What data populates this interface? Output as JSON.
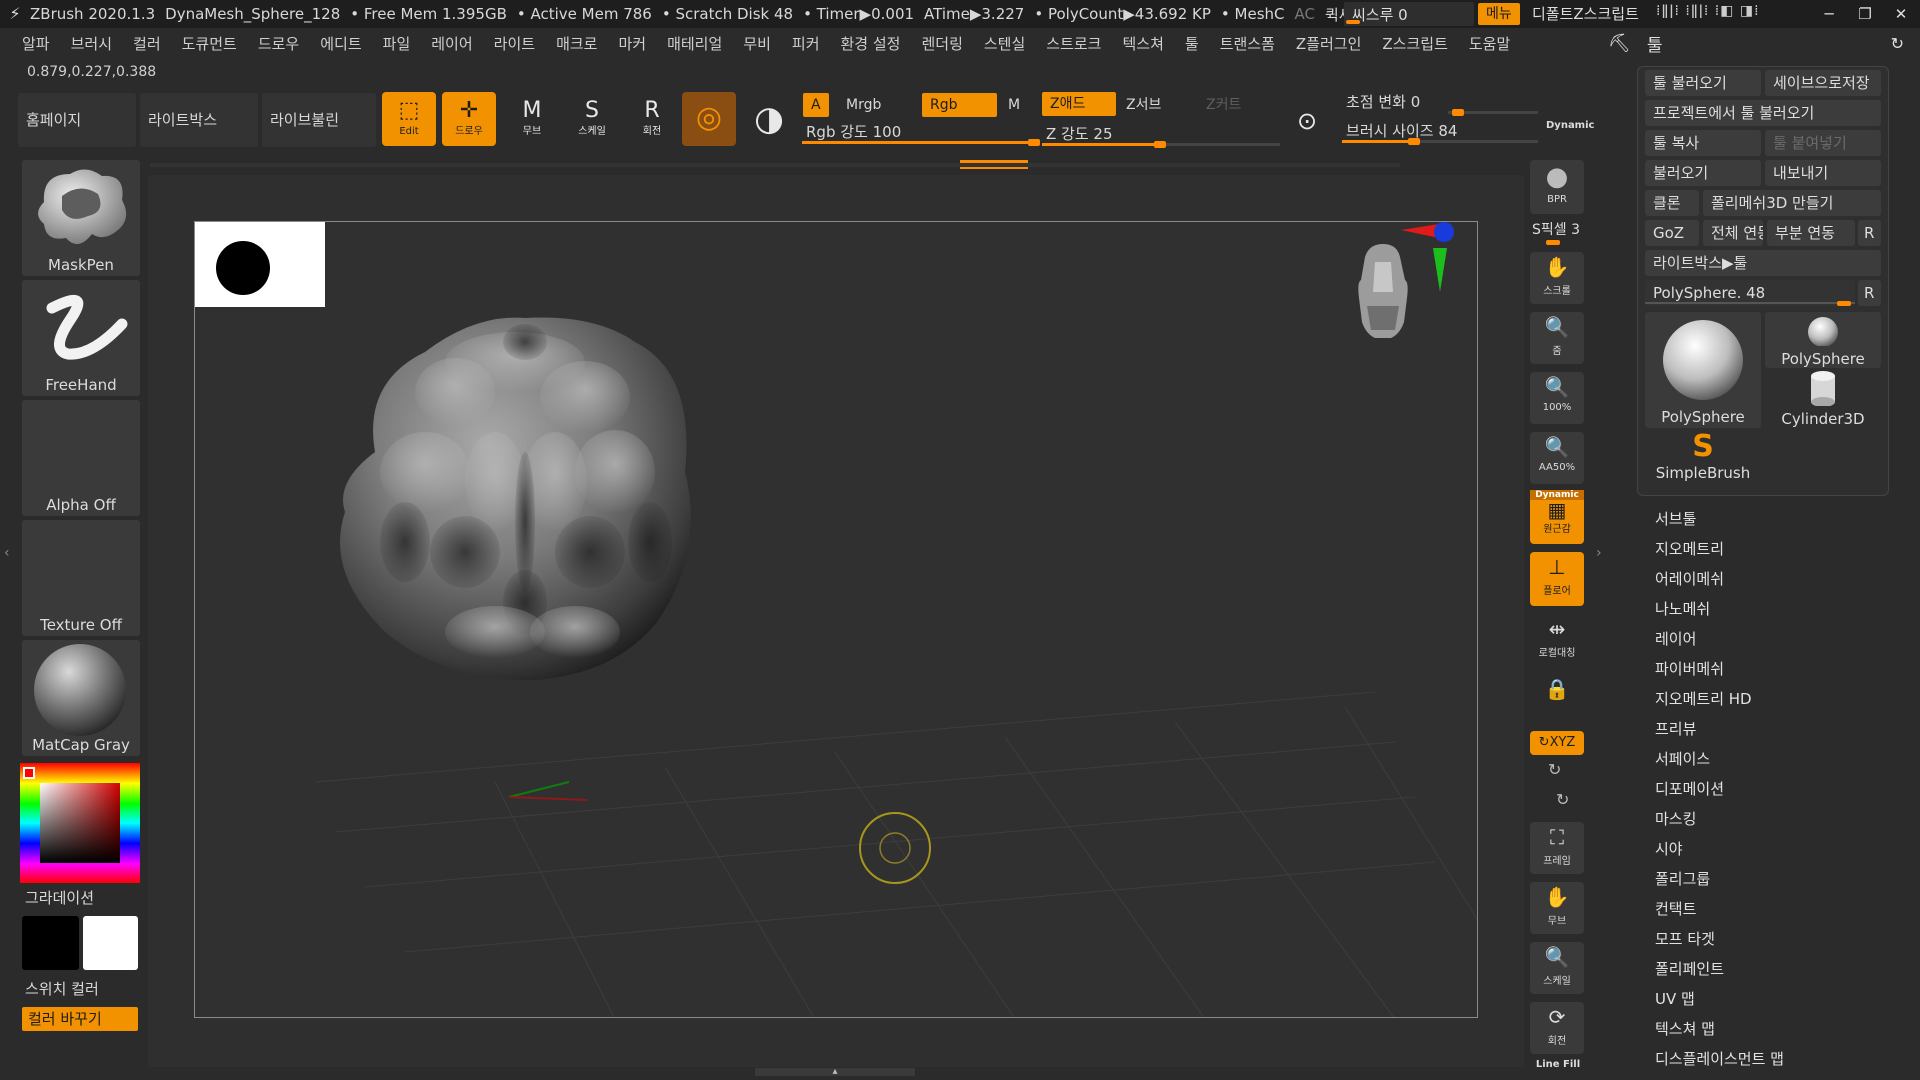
{
  "titlebar": {
    "app": "ZBrush 2020.1.3",
    "document": "DynaMesh_Sphere_128",
    "free_mem": "• Free Mem 1.395GB",
    "active_mem": "• Active Mem 786",
    "scratch": "• Scratch Disk 48",
    "timer": "• Timer▶0.001",
    "atime": "ATime▶3.227",
    "polycount": "• PolyCount▶43.692 KP",
    "meshc": "• MeshC",
    "ac": "AC",
    "quicksave": "퀵세이브",
    "see_through_label": "씨스루 0",
    "see_through_value": 0,
    "menu_btn": "메뉴",
    "default_script": "디폴트Z스크립트",
    "minimize": "─",
    "restore": "❐",
    "close": "✕"
  },
  "menubar": [
    "알파",
    "브러시",
    "컬러",
    "도큐먼트",
    "드로우",
    "에디트",
    "파일",
    "레이어",
    "라이트",
    "매크로",
    "마커",
    "매테리얼",
    "무비",
    "피커",
    "환경 설정",
    "렌더링",
    "스텐실",
    "스트로크",
    "텍스쳐",
    "툴",
    "트랜스폼",
    "Z플러그인",
    "Z스크립트",
    "도움말"
  ],
  "tool_header": {
    "title": "툴"
  },
  "coords": "0.879,0.227,0.388",
  "shelf": {
    "home": "홈페이지",
    "lightbox": "라이트박스",
    "live_boolean": "라이브불린",
    "edit": "Edit",
    "draw": "드로우",
    "move": "무브",
    "scale": "스케일",
    "rotate": "회전",
    "a_label": "A",
    "mrgb": "Mrgb",
    "rgb": "Rgb",
    "m": "M",
    "zadd": "Z애드",
    "zsub": "Z서브",
    "zcut": "Z커트",
    "rgb_intensity_label": "Rgb 강도 100",
    "rgb_intensity": 100,
    "z_intensity_label": "Z 강도 25",
    "z_intensity": 25,
    "focal_shift_label": "초점 변화 0",
    "focal_shift": 0,
    "draw_size_label": "브러시 사이즈 84",
    "draw_size": 84,
    "dynamic": "Dynamic"
  },
  "left_palette": {
    "brush": "MaskPen",
    "stroke": "FreeHand",
    "alpha": "Alpha Off",
    "texture": "Texture Off",
    "material": "MatCap Gray",
    "gradient": "그라데이션",
    "switch_color": "스위치 컬러",
    "alternate": "컬러 바꾸기"
  },
  "right_column": {
    "bpr": "BPR",
    "spix": "S픽셀 3",
    "scroll": "스크롤",
    "zoom": "줌",
    "actual": "100%",
    "aahalf": "AA50%",
    "dynamic_tag": "Dynamic",
    "persp": "원근감",
    "floor": "플로어",
    "local": "로컬대칭",
    "lock": "",
    "xyz": "XYZ",
    "frame": "프레임",
    "move": "무브",
    "scale": "스케일",
    "rotate": "회전",
    "linefill": "Line Fill"
  },
  "tool_panel": {
    "load_tool": "툴 불러오기",
    "save_as": "세이브으로저장",
    "load_from_project": "프로젝트에서 툴 불러오기",
    "copy_tool": "툴 복사",
    "paste_tool": "툴 붙여넣기",
    "import": "불러오기",
    "export": "내보내기",
    "clone": "클론",
    "make_polymesh": "폴리메쉬3D 만들기",
    "goz": "GoZ",
    "all": "전체 연동",
    "visible": "부분 연동",
    "r": "R",
    "lightbox_tools": "라이트박스▶툴",
    "polysphere_slider": "PolySphere. 48",
    "polysphere_value": 48,
    "thumb_main": "PolySphere",
    "thumb_polysphere": "PolySphere",
    "thumb_cylinder": "Cylinder3D",
    "thumb_simple": "SimpleBrush"
  },
  "sub_menus": [
    "서브툴",
    "지오메트리",
    "어레이메쉬",
    "나노메쉬",
    "레이어",
    "파이버메쉬",
    "지오메트리 HD",
    "프리뷰",
    "서페이스",
    "디포메이션",
    "마스킹",
    "시야",
    "폴리그룹",
    "컨택트",
    "모프 타겟",
    "폴리페인트",
    "UV 맵",
    "텍스쳐 맵",
    "디스플레이스먼트 맵"
  ],
  "colors": {
    "accent": "#f29200",
    "panel": "#2f2f2f",
    "background": "#2b2b2b"
  }
}
